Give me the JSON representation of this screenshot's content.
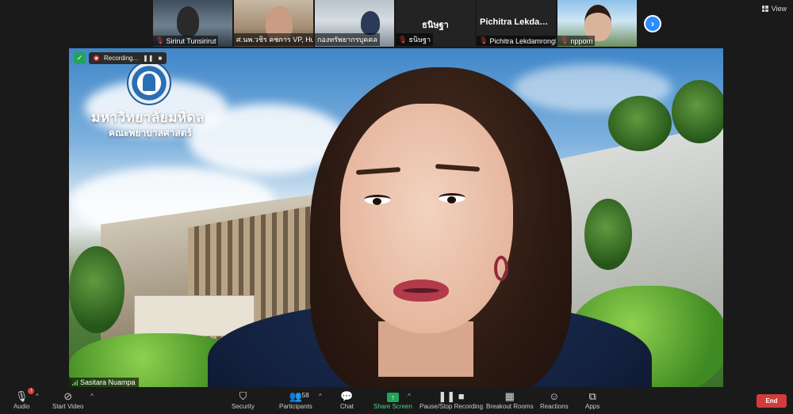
{
  "gallery": {
    "tiles": [
      {
        "name": "Sirirut Tunsirirut",
        "muted": true,
        "video": true
      },
      {
        "name": "ศ.นพ.วชิร คชการ VP, Hum...",
        "muted": false,
        "video": true
      },
      {
        "name": "กองทรัพยากรบุคคล",
        "muted": false,
        "video": true
      },
      {
        "name": "ธนิษฐา",
        "display_name": "ธนิษฐา",
        "muted": true,
        "video": false
      },
      {
        "name": "Pichitra Lekdamrongkul",
        "display_name": "Pichitra  Lekdam...",
        "muted": true,
        "video": false
      },
      {
        "name": "npporn",
        "muted": true,
        "video": true
      }
    ],
    "next_icon": "chevron-right-icon"
  },
  "view": {
    "label": "View"
  },
  "recording": {
    "label": "Recording..."
  },
  "background": {
    "university_name": "มหาวิทยาลัยมหิดล",
    "faculty_name": "คณะพยาบาลศาสตร์"
  },
  "speaker": {
    "name": "Sasitara Nuampa"
  },
  "toolbar": {
    "audio": {
      "label": "Audio",
      "icon": "microphone-muted-icon"
    },
    "video": {
      "label": "Start Video",
      "icon": "video-off-icon"
    },
    "security": {
      "label": "Security",
      "icon": "shield-icon"
    },
    "participants": {
      "label": "Participants",
      "count": "58",
      "icon": "people-icon"
    },
    "chat": {
      "label": "Chat",
      "icon": "chat-bubble-icon"
    },
    "share": {
      "label": "Share Screen",
      "icon": "share-screen-icon"
    },
    "recording": {
      "label": "Pause/Stop Recording",
      "icon": "pause-stop-icon"
    },
    "breakout": {
      "label": "Breakout Rooms",
      "icon": "grid-icon"
    },
    "reactions": {
      "label": "Reactions",
      "icon": "smiley-plus-icon"
    },
    "apps": {
      "label": "Apps",
      "icon": "apps-icon"
    },
    "end": {
      "label": "End"
    }
  },
  "colors": {
    "accent": "#2d8cff",
    "end": "#d43b3b",
    "share": "#23a45b",
    "muted": "#e0453a"
  }
}
